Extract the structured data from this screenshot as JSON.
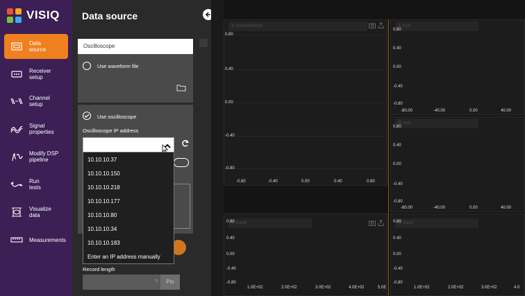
{
  "app": {
    "name": "VISIQ",
    "logo_colors": [
      "#e9542c",
      "#f5a623",
      "#7cc142",
      "#3fa9f5"
    ]
  },
  "sidebar": {
    "items": [
      {
        "label": "Data\nsource",
        "icon": "data-source-icon",
        "active": true
      },
      {
        "label": "Receiver\nsetup",
        "icon": "receiver-icon"
      },
      {
        "label": "Channel\nsetup",
        "icon": "channel-icon"
      },
      {
        "label": "Signal\nproperties",
        "icon": "signal-icon"
      },
      {
        "label": "Modify DSP\npipeline",
        "icon": "dsp-icon"
      },
      {
        "label": "Run\ntests",
        "icon": "run-icon"
      },
      {
        "label": "Visualize\ndata",
        "icon": "visualize-icon"
      },
      {
        "label": "Measurements",
        "icon": "measurements-icon"
      }
    ]
  },
  "panel": {
    "title": "Data source",
    "section": "Oscilloscope",
    "use_waveform_file": "Use waveform file",
    "use_oscilloscope": "Use oscilloscope",
    "ip_label": "Oscilloscope IP address",
    "ip_value": "",
    "dropdown": [
      "10.10.10.37",
      "10.10.10.150",
      "10.10.10.218",
      "10.10.10.177",
      "10.10.10.80",
      "10.10.10.34",
      "10.10.10.183",
      "Enter an IP address manually"
    ],
    "record_length_label": "Record length",
    "record_length_value": "0",
    "record_length_unit": "Pts"
  },
  "plots": {
    "constellation": {
      "title": "X constellation",
      "y_ticks": [
        "0.80",
        "0.40",
        "0.00",
        "-0.40",
        "-0.80"
      ],
      "x_ticks": [
        "-0.80",
        "-0.40",
        "0.00",
        "0.40",
        "0.80"
      ]
    },
    "x_eye": {
      "title": "X eye",
      "y_ticks": [
        "0.80",
        "0.40",
        "0.00",
        "-0.40",
        "-0.80"
      ],
      "x_ticks": [
        "-80.00",
        "-40.00",
        "0.00",
        "40.00"
      ]
    },
    "y_eye": {
      "title": "Q eye",
      "y_ticks": [
        "0.80",
        "0.40",
        "0.00",
        "-0.40",
        "-0.80"
      ],
      "x_ticks": [
        "-80.00",
        "-40.00",
        "0.00",
        "40.00"
      ]
    },
    "x_trace": {
      "title": "X trace",
      "y_ticks": [
        "0.80",
        "0.40",
        "0.00",
        "-0.40",
        "-0.80"
      ],
      "x_ticks": [
        "1.0E+02",
        "2.0E+02",
        "3.0E+02",
        "4.0E+02",
        "5.0E"
      ]
    },
    "y_trace": {
      "title": "Q trace",
      "y_ticks": [
        "0.80",
        "0.40",
        "0.00",
        "-0.40",
        "-0.80"
      ],
      "x_ticks": [
        "1.0E+02",
        "2.0E+02",
        "3.0E+02",
        "4.0"
      ]
    }
  }
}
